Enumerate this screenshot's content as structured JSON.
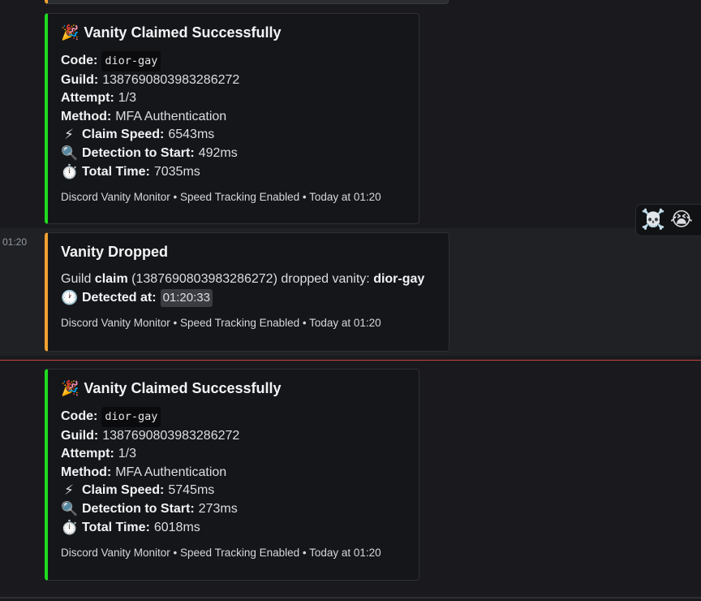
{
  "colors": {
    "claimed_accent": "#1fdb1f",
    "dropped_accent": "#f0a030",
    "new_messages_divider": "#c8443f"
  },
  "reactions": [
    {
      "icon": "skull-crossbones-icon",
      "glyph": "☠️"
    },
    {
      "icon": "loudly-crying-face-icon",
      "glyph": "😭"
    }
  ],
  "messages": [
    {
      "type": "claimed",
      "title_emoji": "🎉",
      "title": "Vanity Claimed Successfully",
      "code_label": "Code:",
      "code_value": "dior-gay",
      "guild_label": "Guild:",
      "guild_value": "1387690803983286272",
      "attempt_label": "Attempt:",
      "attempt_value": "1/3",
      "method_label": "Method:",
      "method_value": "MFA Authentication",
      "speed_emoji": "⚡",
      "speed_label": "Claim Speed:",
      "speed_value": "6543ms",
      "detect_emoji": "🔍",
      "detect_label": "Detection to Start:",
      "detect_value": "492ms",
      "total_emoji": "⏱️",
      "total_label": "Total Time:",
      "total_value": "7035ms",
      "footer": "Discord Vanity Monitor • Speed Tracking Enabled • Today at 01:20"
    },
    {
      "type": "dropped",
      "timestamp": "01:20",
      "title": "Vanity Dropped",
      "desc_prefix": "Guild ",
      "desc_guild_name": "claim",
      "desc_middle": " (1387690803983286272) dropped vanity: ",
      "desc_vanity": "dior-gay",
      "detected_emoji": "🕐",
      "detected_label": "Detected at:",
      "detected_value": "01:20:33",
      "footer": "Discord Vanity Monitor • Speed Tracking Enabled • Today at 01:20"
    },
    {
      "type": "claimed",
      "title_emoji": "🎉",
      "title": "Vanity Claimed Successfully",
      "code_label": "Code:",
      "code_value": "dior-gay",
      "guild_label": "Guild:",
      "guild_value": "1387690803983286272",
      "attempt_label": "Attempt:",
      "attempt_value": "1/3",
      "method_label": "Method:",
      "method_value": "MFA Authentication",
      "speed_emoji": "⚡",
      "speed_label": "Claim Speed:",
      "speed_value": "5745ms",
      "detect_emoji": "🔍",
      "detect_label": "Detection to Start:",
      "detect_value": "273ms",
      "total_emoji": "⏱️",
      "total_label": "Total Time:",
      "total_value": "6018ms",
      "footer": "Discord Vanity Monitor • Speed Tracking Enabled • Today at 01:20"
    }
  ]
}
